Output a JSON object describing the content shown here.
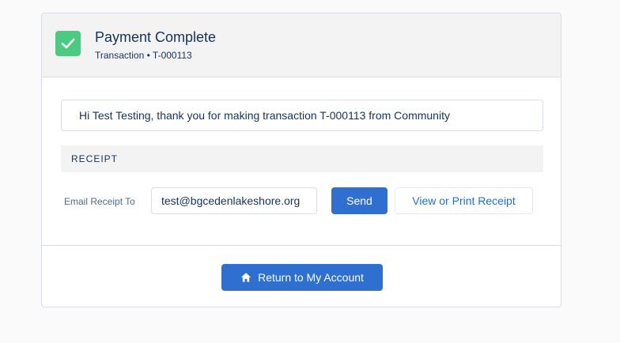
{
  "header": {
    "title": "Payment Complete",
    "subtitle": "Transaction • T-000113",
    "status_icon": "check-icon",
    "status_color": "#4bca81"
  },
  "message": "Hi Test Testing, thank you for making transaction T-000113 from Community",
  "receipt": {
    "section_title": "RECEIPT",
    "email_label": "Email Receipt To",
    "email_value": "test@bgcedenlakeshore.org",
    "send_label": "Send",
    "print_label": "View or Print Receipt"
  },
  "footer": {
    "return_label": "Return to My Account",
    "return_icon": "home-icon"
  },
  "colors": {
    "brand_blue": "#2e6fd0",
    "link_blue": "#1f6fd1",
    "text_dark": "#16325c"
  }
}
